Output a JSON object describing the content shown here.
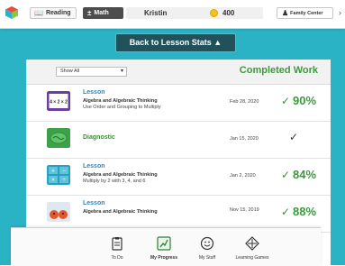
{
  "topbar": {
    "logo_icon": "cube-logo-icon",
    "tabs": [
      {
        "label": "Reading",
        "icon": "book-icon"
      },
      {
        "label": "Math",
        "icon": "math-symbols-icon",
        "active": true
      }
    ],
    "user_name": "Kristin",
    "points": "400",
    "family_center": "Family Center"
  },
  "back_button": "Back to Lesson Stats ▲",
  "filter": {
    "selected": "Show All"
  },
  "completed_heading": "Completed Work",
  "rows": [
    {
      "title": "Lesson",
      "subject": "Algebra and Algebraic Thinking",
      "desc": "Use Order and Grouping to Multiply",
      "date": "Feb 28, 2020",
      "score": "90%",
      "thumb_text": "4 × 2 × 2"
    },
    {
      "title": "Diagnostic",
      "date": "Jan 15, 2020"
    },
    {
      "title": "Lesson",
      "subject": "Algebra and Algebraic Thinking",
      "desc": "Multiply by 2 with 3, 4, and 6",
      "date": "Jan 2, 2020",
      "score": "84%"
    },
    {
      "title": "Lesson",
      "subject": "Algebra and Algebraic Thinking",
      "date": "Nov 15, 2019",
      "score": "88%"
    }
  ],
  "bottom_nav": [
    {
      "label": "To Do",
      "icon": "clipboard-icon"
    },
    {
      "label": "My Progress",
      "icon": "chart-icon",
      "active": true
    },
    {
      "label": "My Stuff",
      "icon": "smiley-icon"
    },
    {
      "label": "Learning Games",
      "icon": "games-icon"
    }
  ],
  "colors": {
    "teal": "#2ab3c5",
    "dark_teal": "#21525c",
    "green": "#3a9a3a",
    "blue": "#2a86c4"
  }
}
